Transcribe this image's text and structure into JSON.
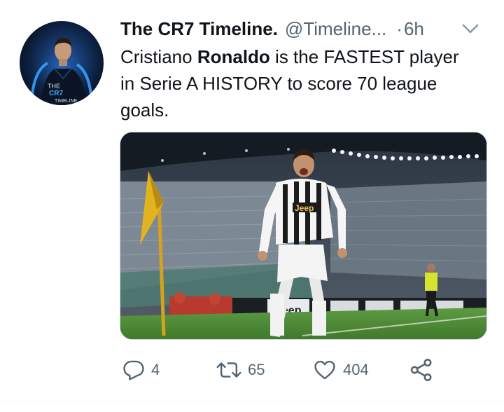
{
  "tweet": {
    "display_name": "The CR7 Timeline.",
    "handle": "@Timeline...",
    "separator": "·",
    "time": "6h",
    "text_parts": {
      "part1": "Cristiano ",
      "bold": "Ronaldo",
      "part2": " is the FASTEST player in Serie A HISTORY to score 70 league goals."
    }
  },
  "avatar": {
    "line1": "THE",
    "line2": "CR7",
    "line3": "TIMELINE"
  },
  "media": {
    "shirt_sponsor": "Jeep",
    "board_text": "Jeep"
  },
  "actions": {
    "reply_count": "4",
    "retweet_count": "65",
    "like_count": "404"
  },
  "icons": {
    "reply": "reply-icon",
    "retweet": "retweet-icon",
    "like": "heart-icon",
    "share": "share-icon",
    "more": "chevron-down-icon"
  },
  "colors": {
    "text": "#0f1419",
    "secondary": "#536471",
    "avatar_glow": "#2f8cff"
  }
}
